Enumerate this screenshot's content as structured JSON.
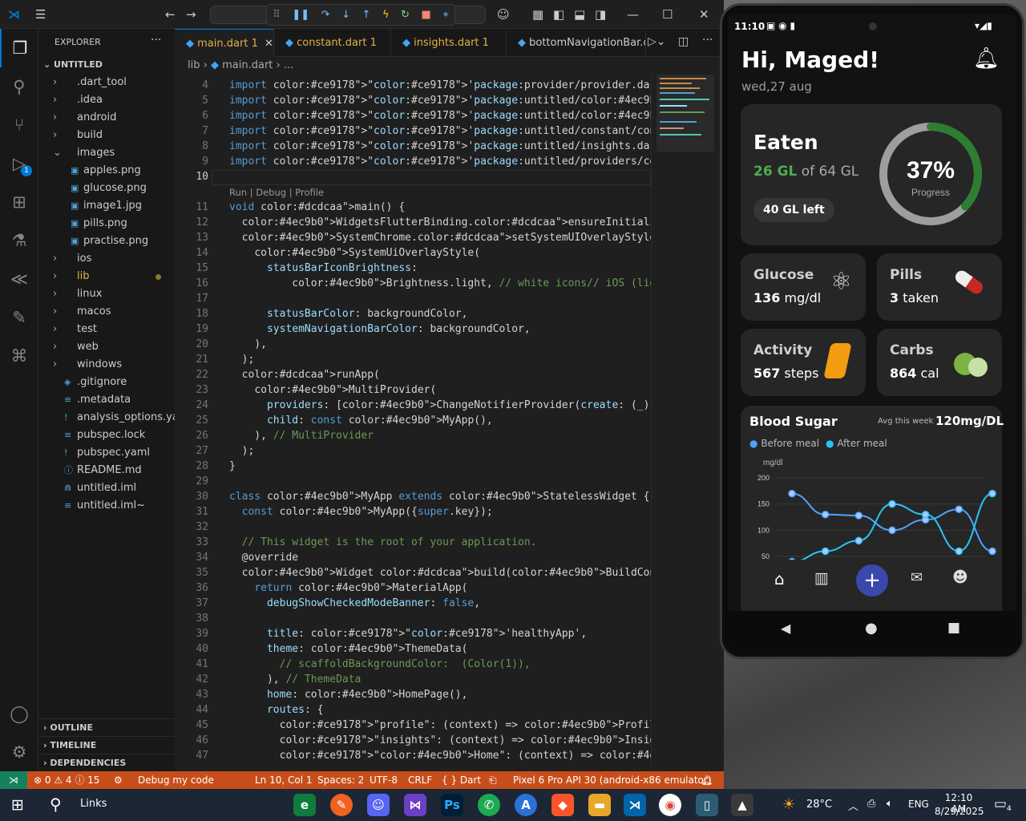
{
  "vscode": {
    "sidebar": {
      "title": "EXPLORER",
      "project": "UNTITLED",
      "items": [
        {
          "chevron": "›",
          "icon": "",
          "label": ".dart_tool"
        },
        {
          "chevron": "›",
          "icon": "",
          "label": ".idea"
        },
        {
          "chevron": "›",
          "icon": "",
          "label": "android"
        },
        {
          "chevron": "›",
          "icon": "",
          "label": "build"
        },
        {
          "chevron": "⌄",
          "icon": "",
          "label": "images"
        },
        {
          "chevron": "",
          "icon": "▣",
          "label": "apples.png"
        },
        {
          "chevron": "",
          "icon": "▣",
          "label": "glucose.png"
        },
        {
          "chevron": "",
          "icon": "▣",
          "label": "image1.jpg"
        },
        {
          "chevron": "",
          "icon": "▣",
          "label": "pills.png"
        },
        {
          "chevron": "",
          "icon": "▣",
          "label": "practise.png"
        },
        {
          "chevron": "›",
          "icon": "",
          "label": "ios"
        },
        {
          "chevron": "›",
          "icon": "",
          "label": "lib"
        },
        {
          "chevron": "›",
          "icon": "",
          "label": "linux"
        },
        {
          "chevron": "›",
          "icon": "",
          "label": "macos"
        },
        {
          "chevron": "›",
          "icon": "",
          "label": "test"
        },
        {
          "chevron": "›",
          "icon": "",
          "label": "web"
        },
        {
          "chevron": "›",
          "icon": "",
          "label": "windows"
        },
        {
          "chevron": "",
          "icon": "◈",
          "label": ".gitignore"
        },
        {
          "chevron": "",
          "icon": "≡",
          "label": ".metadata"
        },
        {
          "chevron": "",
          "icon": "!",
          "label": "analysis_options.yaml"
        },
        {
          "chevron": "",
          "icon": "≡",
          "label": "pubspec.lock"
        },
        {
          "chevron": "",
          "icon": "!",
          "label": "pubspec.yaml"
        },
        {
          "chevron": "",
          "icon": "ⓘ",
          "label": "README.md"
        },
        {
          "chevron": "",
          "icon": "⋒",
          "label": "untitled.iml"
        },
        {
          "chevron": "",
          "icon": "≡",
          "label": "untitled.iml~"
        }
      ],
      "outline": "OUTLINE",
      "timeline": "TIMELINE",
      "dependencies": "DEPENDENCIES"
    },
    "tabs": [
      {
        "label": "main.dart",
        "badge": "1",
        "active": true
      },
      {
        "label": "constant.dart",
        "badge": "1",
        "active": false
      },
      {
        "label": "insights.dart",
        "badge": "1",
        "active": false
      },
      {
        "label": "bottomNavigationBar.da",
        "badge": "",
        "active": false
      }
    ],
    "breadcrumb": {
      "folder": "lib",
      "sep": "›",
      "file": "main.dart",
      "tail": "› ..."
    },
    "codelens": "Run | Debug | Profile",
    "code_lines": [
      {
        "n": "4",
        "t": "import 'package:provider/provider.dart';"
      },
      {
        "n": "5",
        "t": "import 'package:untitled/Home.dart';"
      },
      {
        "n": "6",
        "t": "import 'package:untitled/ProfilePage.dart';"
      },
      {
        "n": "7",
        "t": "import 'package:untitled/constant/constant.dart';"
      },
      {
        "n": "8",
        "t": "import 'package:untitled/insights.dart';"
      },
      {
        "n": "9",
        "t": "import 'package:untitled/providers/NavigationProvider.dart';"
      },
      {
        "n": "10",
        "t": ""
      },
      {
        "n": "11",
        "t": "void main() {"
      },
      {
        "n": "12",
        "t": "  WidgetsFlutterBinding.ensureInitialized();"
      },
      {
        "n": "13",
        "t": "  SystemChrome.setSystemUIOverlayStyle("
      },
      {
        "n": "14",
        "t": "    SystemUiOverlayStyle("
      },
      {
        "n": "15",
        "t": "      statusBarIconBrightness:"
      },
      {
        "n": "16",
        "t": "          Brightness.light, // white icons// iOS (light content)"
      },
      {
        "n": "17",
        "t": ""
      },
      {
        "n": "18",
        "t": "      statusBarColor: backgroundColor,"
      },
      {
        "n": "19",
        "t": "      systemNavigationBarColor: backgroundColor,"
      },
      {
        "n": "20",
        "t": "    ),"
      },
      {
        "n": "21",
        "t": "  );"
      },
      {
        "n": "22",
        "t": "  runApp("
      },
      {
        "n": "23",
        "t": "    MultiProvider("
      },
      {
        "n": "24",
        "t": "      providers: [ChangeNotifierProvider(create: (_) => NavigationPro"
      },
      {
        "n": "25",
        "t": "      child: const MyApp(),"
      },
      {
        "n": "26",
        "t": "    ), // MultiProvider"
      },
      {
        "n": "27",
        "t": "  );"
      },
      {
        "n": "28",
        "t": "}"
      },
      {
        "n": "29",
        "t": ""
      },
      {
        "n": "30",
        "t": "class MyApp extends StatelessWidget {"
      },
      {
        "n": "31",
        "t": "  const MyApp({super.key});"
      },
      {
        "n": "32",
        "t": ""
      },
      {
        "n": "33",
        "t": "  // This widget is the root of your application."
      },
      {
        "n": "34",
        "t": "  @override"
      },
      {
        "n": "35",
        "t": "  Widget build(BuildContext context) {"
      },
      {
        "n": "36",
        "t": "    return MaterialApp("
      },
      {
        "n": "37",
        "t": "      debugShowCheckedModeBanner: false,"
      },
      {
        "n": "38",
        "t": ""
      },
      {
        "n": "39",
        "t": "      title: 'healthyApp',"
      },
      {
        "n": "40",
        "t": "      theme: ThemeData("
      },
      {
        "n": "41",
        "t": "        // scaffoldBackgroundColor:  (Color(1)),"
      },
      {
        "n": "42",
        "t": "      ), // ThemeData"
      },
      {
        "n": "43",
        "t": "      home: HomePage(),"
      },
      {
        "n": "44",
        "t": "      routes: {"
      },
      {
        "n": "45",
        "t": "        \"profile\": (context) => Profilepage(),"
      },
      {
        "n": "46",
        "t": "        \"insights\": (context) => Insights(),"
      },
      {
        "n": "47",
        "t": "        \"Home\": (context) => HomePage(),"
      }
    ],
    "statusbar": {
      "errors": "⊗ 0 ⚠ 4 ⓘ 15",
      "debug": "Debug my code",
      "position": "Ln 10, Col 1",
      "spaces": "Spaces: 2",
      "encoding": "UTF-8",
      "eol": "CRLF",
      "language": "{ } Dart",
      "device": "Pixel 6 Pro API 30 (android-x86 emulator)"
    }
  },
  "phone": {
    "status": {
      "time": "11:10"
    },
    "greeting": "Hi, Maged!",
    "date": "wed,27 aug",
    "eaten": {
      "title": "Eaten",
      "amount": "26 GL",
      "of": "of 64 GL",
      "left": "40 GL left",
      "percent": "37%",
      "progress_label": "Progress",
      "progress": 0.37
    },
    "cards": [
      {
        "title": "Glucose",
        "value": "136",
        "unit": "mg/dl"
      },
      {
        "title": "Pills",
        "value": "3",
        "unit": "taken"
      },
      {
        "title": "Activity",
        "value": "567",
        "unit": "steps"
      },
      {
        "title": "Carbs",
        "value": "864",
        "unit": "cal"
      }
    ],
    "blood_sugar": {
      "title": "Blood Sugar",
      "avg_label": "Avg this week",
      "avg_value": "120mg/DL",
      "legend_before": "Before meal",
      "legend_after": "After meal",
      "ylabel": "mg/dl"
    },
    "colors": {
      "accent": "#2e7d32",
      "ring_track": "#9e9e9e",
      "nav_fab": "#3949ab",
      "before": "#4da3ff",
      "after": "#29c4f6"
    }
  },
  "chart_data": {
    "type": "line",
    "title": "Blood Sugar",
    "ylabel": "mg/dl",
    "xlabel": "",
    "ylim": [
      50,
      200
    ],
    "yticks": [
      "200",
      "150",
      "100",
      "50"
    ],
    "x": [
      0,
      1,
      2,
      3,
      4,
      5,
      6
    ],
    "series": [
      {
        "name": "Before meal",
        "values": [
          170,
          130,
          128,
          100,
          120,
          140,
          60
        ]
      },
      {
        "name": "After meal",
        "values": [
          40,
          60,
          80,
          150,
          130,
          60,
          170
        ]
      }
    ]
  },
  "taskbar": {
    "search": "Links",
    "weather": "28°C",
    "lang": "ENG",
    "time": "12:10 AM",
    "date": "8/29/2025",
    "notifications": "4"
  }
}
